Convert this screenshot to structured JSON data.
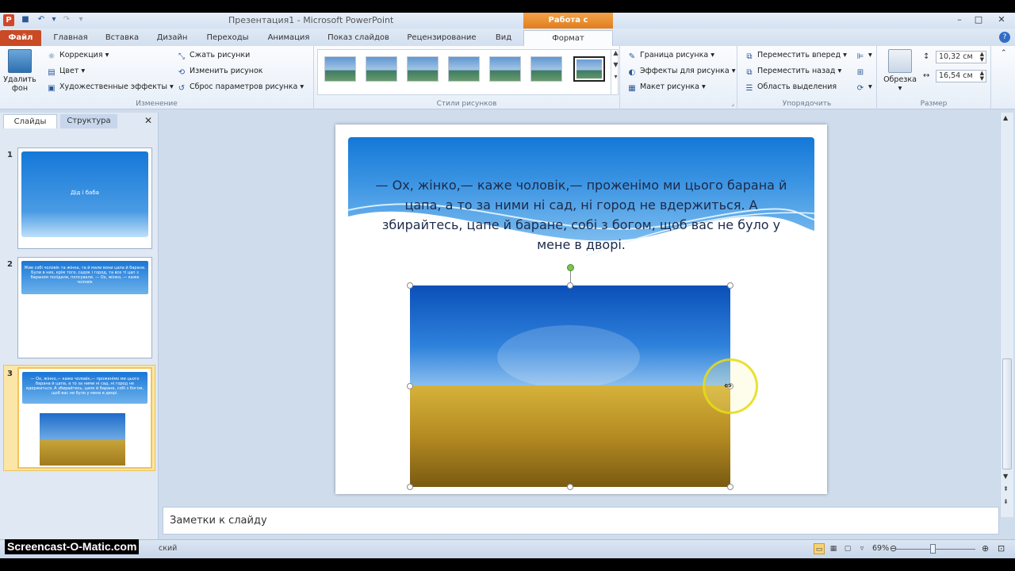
{
  "window": {
    "title": "Презентация1 - Microsoft PowerPoint",
    "context_tab_header": "Работа с рисунками"
  },
  "tabs": [
    {
      "label": "Файл"
    },
    {
      "label": "Главная"
    },
    {
      "label": "Вставка"
    },
    {
      "label": "Дизайн"
    },
    {
      "label": "Переходы"
    },
    {
      "label": "Анимация"
    },
    {
      "label": "Показ слайдов"
    },
    {
      "label": "Рецензирование"
    },
    {
      "label": "Вид"
    },
    {
      "label": "Формат"
    }
  ],
  "ribbon": {
    "remove_bg": "Удалить фон",
    "correction": "Коррекция",
    "color": "Цвет",
    "artistic": "Художественные эффекты",
    "compress": "Сжать рисунки",
    "change": "Изменить рисунок",
    "reset": "Сброс параметров рисунка",
    "group_change": "Изменение",
    "group_styles": "Стили рисунков",
    "border": "Граница рисунка",
    "effects": "Эффекты для рисунка",
    "layout": "Макет рисунка",
    "bring_forward": "Переместить вперед",
    "send_backward": "Переместить назад",
    "selection_pane": "Область выделения",
    "group_arrange": "Упорядочить",
    "crop": "Обрезка",
    "height": "10,32 см",
    "width": "16,54 см",
    "group_size": "Размер"
  },
  "left_pane": {
    "tab_slides": "Слайды",
    "tab_outline": "Структура",
    "slides": [
      {
        "num": "1",
        "text": "Дід і баба"
      },
      {
        "num": "2",
        "text": "Жив собі чоловік та жінка, та й мали вони цапа й барана. Були в них, крім того, садок і город, та все ті цап з бараном позїдали, попсували. — Ох, жінко, — каже чоловік"
      },
      {
        "num": "3",
        "text": "— Ох, жінко,— каже чоловік,— проженімо ми цього барана й цапа, а то за ними ні сад, ні город не вдержиться. А збирайтесь, цапе й баране, собі з богом, щоб вас не було у мене в дворі."
      }
    ]
  },
  "slide": {
    "text": "— Ох, жінко,— каже чоловік,— проженімо ми цього барана й цапа, а то за ними ні сад, ні город не вдержиться. А збирайтесь, цапе й баране, собі з богом, щоб вас не було у мене в дворі."
  },
  "notes": {
    "placeholder": "Заметки к слайду"
  },
  "status": {
    "language": "ский",
    "zoom": "69%"
  },
  "watermark": "Screencast-O-Matic.com",
  "colors": {
    "file_tab": "#c94a25",
    "context_header": "#e98c2a",
    "slide_banner": "#1478d8"
  }
}
